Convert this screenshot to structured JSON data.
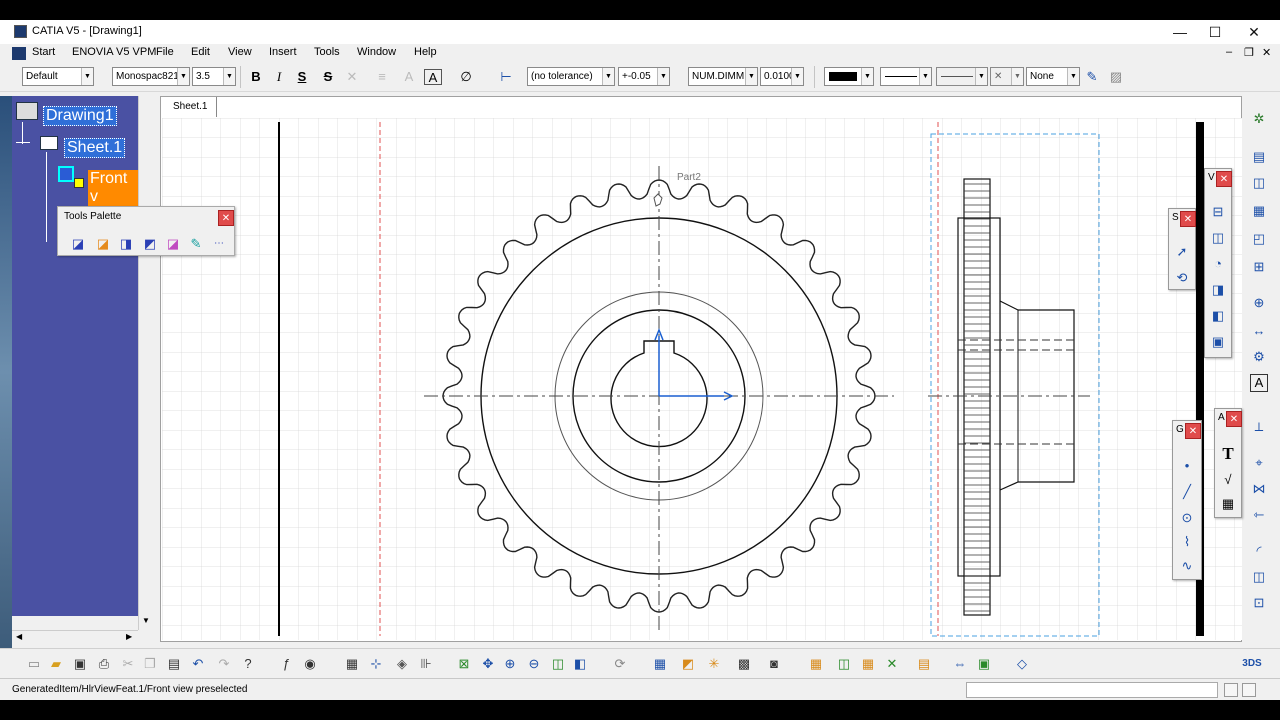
{
  "window": {
    "title": "CATIA V5 - [Drawing1]",
    "controls": {
      "minimize": "—",
      "maximize": "☐",
      "close": "✕"
    }
  },
  "menu": {
    "items": [
      "Start",
      "ENOVIA V5 VPM",
      "File",
      "Edit",
      "View",
      "Insert",
      "Tools",
      "Window",
      "Help"
    ],
    "doc_controls": {
      "minimize": "–",
      "restore": "❐",
      "close": "✕"
    }
  },
  "toolbar": {
    "style_combo": "Default",
    "font_combo": "Monospac821",
    "size_combo": "3.5",
    "bold": "B",
    "italic": "I",
    "underline": "S",
    "strike": "S",
    "tolerance_combo": "(no tolerance)",
    "tol_value_combo": "+-0.05",
    "num_combo": "NUM.DIMM",
    "precision_combo": "0.0100",
    "linetype_none": "None"
  },
  "tree": {
    "root": "Drawing1",
    "sheet": "Sheet.1",
    "view": "Front v"
  },
  "tools_palette": {
    "title": "Tools Palette",
    "close": "✕"
  },
  "sheet_tab": "Sheet.1",
  "drawing": {
    "part_label": "Part2"
  },
  "floating_bars": {
    "v_label": "V",
    "s_label": "S",
    "a_label": "A",
    "g_label": "G",
    "text_tool": "T"
  },
  "status": {
    "message": "GeneratedItem/HlrViewFeat.1/Front view preselected"
  },
  "colors": {
    "tree_bg": "#4a51a3",
    "tree_selected": "#2f6fd8",
    "view_highlight": "#ff8a00",
    "view_frame_red": "#e05050",
    "view_frame_blue": "#4aa0e0",
    "axis_blue": "#1a5fd0"
  }
}
